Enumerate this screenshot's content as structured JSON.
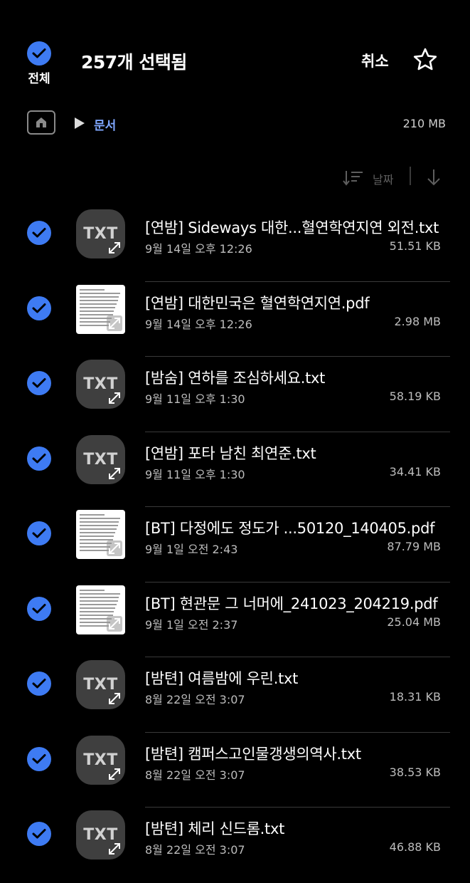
{
  "header": {
    "select_all_label": "전체",
    "title": "257개 선택됨",
    "cancel_label": "취소"
  },
  "path": {
    "folder": "문서",
    "storage_used": "210 MB"
  },
  "sort": {
    "label": "날짜"
  },
  "colors": {
    "accent": "#3e7bf3",
    "path_link": "#7fa7ff",
    "background": "#000000"
  },
  "files": [
    {
      "type": "txt",
      "thumb_label": "TXT",
      "name": "[연밤] Sideways 대한...혈연학연지연 외전.txt",
      "date": "9월 14일 오후 12:26",
      "size": "51.51 KB",
      "selected": true
    },
    {
      "type": "pdf",
      "thumb_label": "",
      "name": "[연밤] 대한민국은 혈연학연지연.pdf",
      "date": "9월 14일 오후 12:26",
      "size": "2.98 MB",
      "selected": true
    },
    {
      "type": "txt",
      "thumb_label": "TXT",
      "name": "[밤숨] 연하를 조심하세요.txt",
      "date": "9월 11일 오후 1:30",
      "size": "58.19 KB",
      "selected": true
    },
    {
      "type": "txt",
      "thumb_label": "TXT",
      "name": "[연밤] 포타 남친 최연준.txt",
      "date": "9월 11일 오후 1:30",
      "size": "34.41 KB",
      "selected": true
    },
    {
      "type": "pdf",
      "thumb_label": "",
      "name": "[BT] 다정에도 정도가 ...50120_140405.pdf",
      "date": "9월 1일 오전 2:43",
      "size": "87.79 MB",
      "selected": true
    },
    {
      "type": "pdf",
      "thumb_label": "",
      "name": "[BT] 현관문 그 너머에_241023_204219.pdf",
      "date": "9월 1일 오전 2:37",
      "size": "25.04 MB",
      "selected": true
    },
    {
      "type": "txt",
      "thumb_label": "TXT",
      "name": "[밤텬] 여름밤에 우린.txt",
      "date": "8월 22일 오전 3:07",
      "size": "18.31 KB",
      "selected": true
    },
    {
      "type": "txt",
      "thumb_label": "TXT",
      "name": "[밤텬] 캠퍼스고인물갱생의역사.txt",
      "date": "8월 22일 오전 3:07",
      "size": "38.53 KB",
      "selected": true
    },
    {
      "type": "txt",
      "thumb_label": "TXT",
      "name": "[밤텬] 체리 신드롬.txt",
      "date": "8월 22일 오전 3:07",
      "size": "46.88 KB",
      "selected": true
    }
  ]
}
